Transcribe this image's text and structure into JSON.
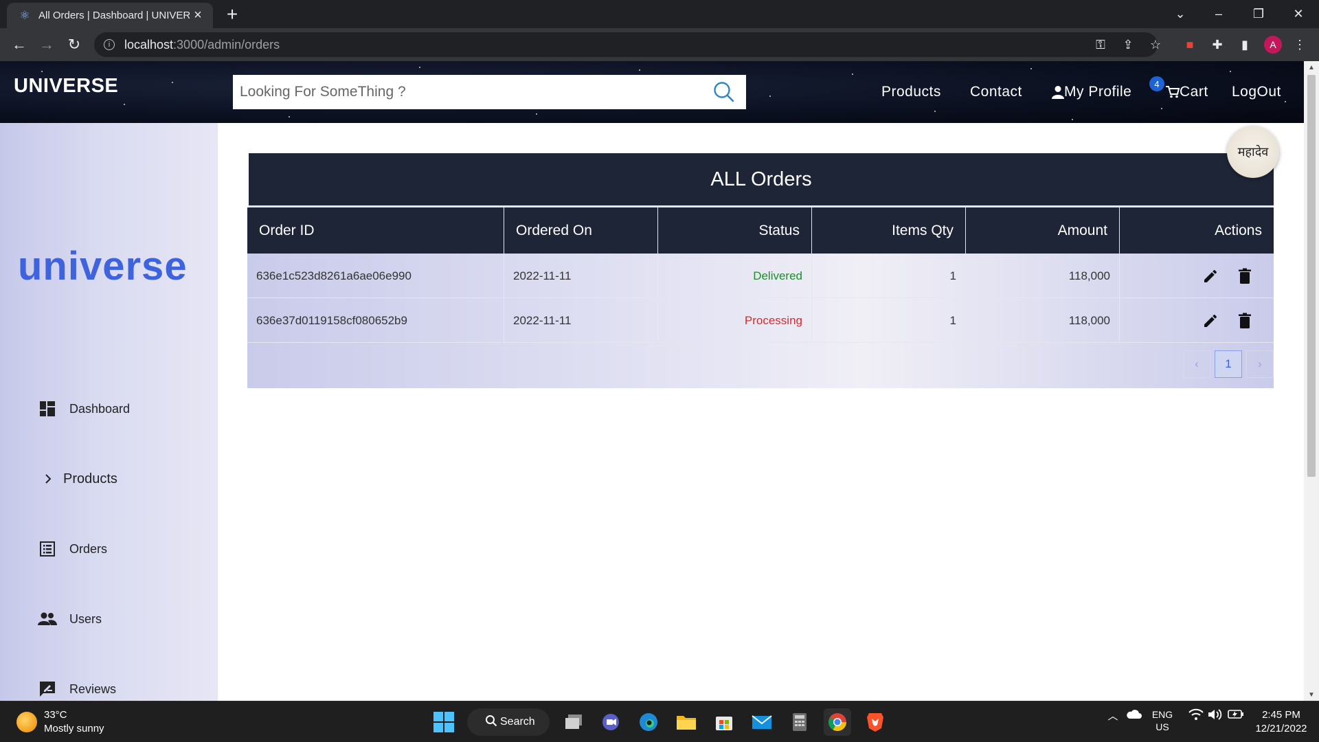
{
  "browser": {
    "tab_title": "All Orders | Dashboard | UNIVERSE",
    "url_host": "localhost",
    "url_rest": ":3000/admin/orders",
    "profile_initial": "A"
  },
  "site": {
    "brand": "UNIVERSE",
    "search_placeholder": "Looking For SomeThing ?",
    "nav": {
      "products": "Products",
      "contact": "Contact",
      "profile": "My Profile",
      "cart": "Cart",
      "cart_count": "4",
      "logout": "LogOut"
    }
  },
  "sidebar": {
    "logo": "universe",
    "items": [
      {
        "label": "Dashboard",
        "icon": "dashboard-icon"
      },
      {
        "label": "Products",
        "icon": "chevron-right-icon"
      },
      {
        "label": "Orders",
        "icon": "list-icon"
      },
      {
        "label": "Users",
        "icon": "users-icon"
      },
      {
        "label": "Reviews",
        "icon": "review-icon"
      }
    ]
  },
  "main": {
    "title": "ALL Orders",
    "columns": [
      "Order ID",
      "Ordered On",
      "Status",
      "Items Qty",
      "Amount",
      "Actions"
    ],
    "rows": [
      {
        "id": "636e1c523d8261a6ae06e990",
        "date": "2022-11-11",
        "status": "Delivered",
        "qty": "1",
        "amount": "118,000"
      },
      {
        "id": "636e37d0119158cf080652b9",
        "date": "2022-11-11",
        "status": "Processing",
        "qty": "1",
        "amount": "118,000"
      }
    ],
    "pager": {
      "prev": "‹",
      "page": "1",
      "next": "›"
    },
    "avatar_text": "महादेव"
  },
  "colors": {
    "delivered": "#1a8f2a",
    "processing": "#d62b2b",
    "header_dark": "#1e2536",
    "accent": "#3e63dd"
  },
  "taskbar": {
    "temp": "33°C",
    "condition": "Mostly sunny",
    "search": "Search",
    "lang": "ENG",
    "region": "US",
    "time": "2:45 PM",
    "date": "12/21/2022"
  }
}
